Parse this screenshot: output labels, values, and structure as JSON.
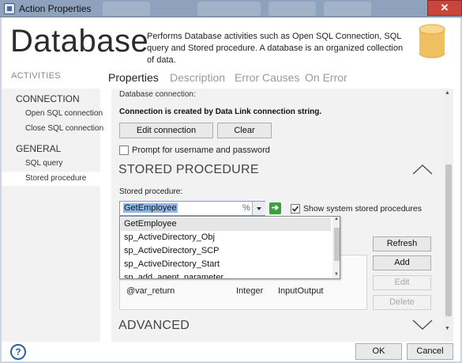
{
  "window": {
    "title": "Action Properties",
    "close_symbol": "✕"
  },
  "header": {
    "title": "Database",
    "description": "Performs Database activities such as Open SQL Connection, SQL query and Stored procedure. A database is an organized collection of data.",
    "icon": "database-icon",
    "accent_color": "#f0c060"
  },
  "sidebar": {
    "heading": "ACTIVITIES",
    "groups": [
      {
        "label": "CONNECTION",
        "items": [
          "Open SQL connection",
          "Close SQL connection"
        ]
      },
      {
        "label": "GENERAL",
        "items": [
          "SQL query",
          "Stored procedure"
        ]
      }
    ],
    "selected": "Stored procedure"
  },
  "tabs": [
    "Properties",
    "Description",
    "Error Causes",
    "On Error"
  ],
  "active_tab": "Properties",
  "connection": {
    "partial_label": "Database connection:",
    "status": "Connection is created by Data Link connection string.",
    "edit_button": "Edit connection",
    "clear_button": "Clear",
    "prompt_checkbox_label": "Prompt for username and password",
    "prompt_checked": false
  },
  "stored_procedure": {
    "section_title": "STORED PROCEDURE",
    "label": "Stored procedure:",
    "value": "GetEmployee",
    "suffix": "%",
    "go_symbol": "➔",
    "show_system_label": "Show system stored procedures",
    "show_system_checked": true,
    "dropdown_options": [
      "GetEmployee",
      "sp_ActiveDirectory_Obj",
      "sp_ActiveDirectory_SCP",
      "sp_ActiveDirectory_Start",
      "sp_add_agent_parameter"
    ],
    "params_row": {
      "name": "@var_return",
      "type": "Integer",
      "direction": "InputOutput"
    },
    "buttons": {
      "refresh": "Refresh",
      "add": "Add",
      "edit": "Edit",
      "delete": "Delete"
    }
  },
  "advanced": {
    "section_title": "ADVANCED"
  },
  "footer": {
    "help_symbol": "?",
    "ok": "OK",
    "cancel": "Cancel"
  }
}
